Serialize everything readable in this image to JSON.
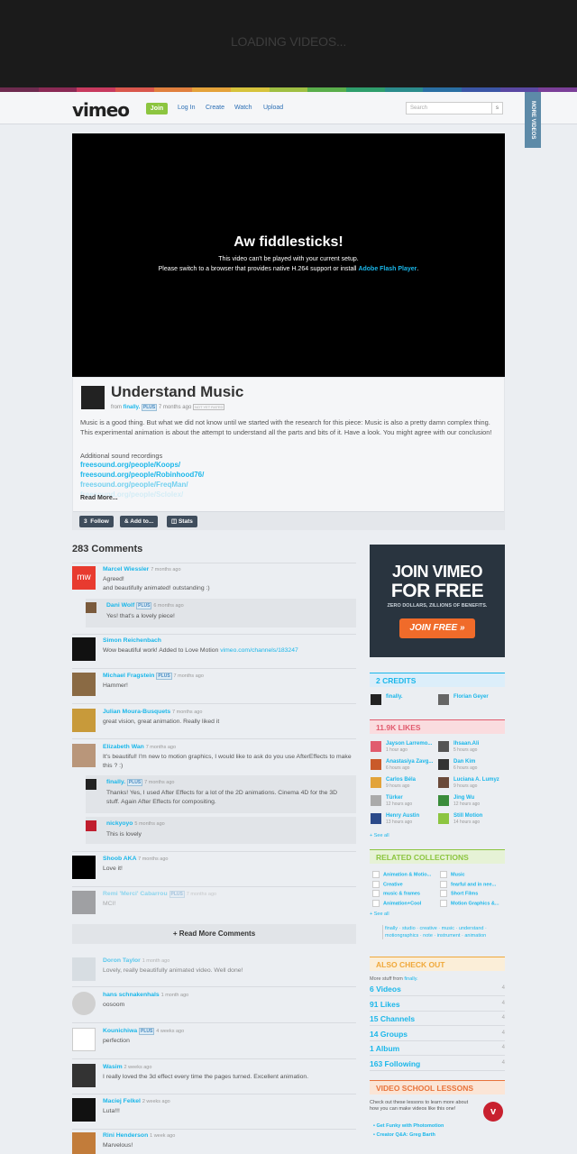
{
  "loading": "LOADING VIDEOS...",
  "stripe": [
    "#6d2b4f",
    "#8a2a55",
    "#c73a5f",
    "#d9574d",
    "#e07f3e",
    "#e4a23a",
    "#d6c33c",
    "#9fbf43",
    "#5aae4b",
    "#2f9e6c",
    "#2b8c8c",
    "#2a6fa3",
    "#3b56a6",
    "#5a48a2",
    "#7b3f98"
  ],
  "header": {
    "logo": "vimeo",
    "join": "Join",
    "login": "Log In",
    "create": "Create",
    "watch": "Watch",
    "upload": "Upload",
    "search_placeholder": "Search",
    "search_btn": "s",
    "more_videos": "MORE VIDEOS"
  },
  "player": {
    "title": "Aw fiddlesticks!",
    "msg1": "This video can't be played with your current setup.",
    "msg2": "Please switch to a browser that provides native H.264 support or install",
    "flash": "Adobe Flash Player",
    "period": "."
  },
  "video": {
    "title": "Understand Music",
    "from": "from",
    "author": "finally.",
    "plus": "PLUS",
    "ago": "7 months ago",
    "rated": "NOT YET RATED",
    "desc": "Music is a good thing. But what we did not know until we started with the research for this piece: Music is also a pretty damn complex thing. This experimental animation is about the attempt to understand all the parts and bits of it. Have a look. You might agree with our conclusion!",
    "additional": "Additional sound recordings",
    "links": [
      "freesound.org/people/Koops/",
      "freesound.org/people/Robinhood76/",
      "freesound.org/people/FreqMan/",
      "freesound.org/people/Sclolex/"
    ],
    "readmore": "Read More...",
    "follow": "Follow",
    "follow_count": "3",
    "addto": "Add to...",
    "stats": "Stats"
  },
  "comments_header": "283 Comments",
  "comments": [
    {
      "name": "Marcel Wiessler",
      "time": "7 months ago",
      "text": "Agreed!\nand beautifully animated! outstanding :)"
    },
    {
      "name": "Dani Wolf",
      "plus": "PLUS",
      "time": "6 months ago",
      "text": "Yes! that's a lovely piece!"
    },
    {
      "name": "Simon Reichenbach",
      "time": "7 months ago",
      "text": "Wow beautiful work! Added to Love Motion",
      "link": "vimeo.com/channels/183247"
    },
    {
      "name": "Michael Fragstein",
      "plus": "PLUS",
      "time": "7 months ago",
      "text": "Hammer!"
    },
    {
      "name": "Julian Moura-Busquets",
      "time": "7 months ago",
      "text": "great vision, great animation. Really liked it"
    },
    {
      "name": "Elizabeth Wan",
      "time": "7 months ago",
      "text": "It's beautiful! I'm new to motion graphics, I would like to ask do you use AfterEffects to make this ? :)"
    },
    {
      "name": "finally.",
      "plus": "PLUS",
      "time": "7 months ago",
      "text": "Thanks! Yes, I used After Effects for a lot of the 2D animations. Cinema 4D for the 3D stuff. Again After Effects for compositing."
    },
    {
      "name": "nickyoyo",
      "time": "5 months ago",
      "text": "This is lovely"
    },
    {
      "name": "Shoob AKA",
      "time": "7 months ago",
      "text": "Love it!"
    },
    {
      "name": "Remi 'Merci' Cabarrou",
      "plus": "PLUS",
      "time": "7 months ago",
      "text": "MCI!"
    }
  ],
  "read_more_comments": "+  Read More Comments",
  "comments2": [
    {
      "name": "Doron Taylor",
      "time": "1 month ago",
      "text": "Lovely, really beautifully animated video. Well done!"
    },
    {
      "name": "hans schnakenhals",
      "time": "1 month ago",
      "text": "oosoom"
    },
    {
      "name": "Kounichiwa",
      "plus": "PLUS",
      "time": "4 weeks ago",
      "text": "perfection"
    },
    {
      "name": "Wasim",
      "time": "2 weeks ago",
      "text": "I really loved the 3d effect every time the pages turned. Excellent animation."
    },
    {
      "name": "Maciej Felkel",
      "time": "2 weeks ago",
      "text": "Luta!!!"
    },
    {
      "name": "Rini Henderson",
      "time": "1 week ago",
      "text": "Marvelous!"
    }
  ],
  "ad": {
    "l1": "JOIN VIMEO",
    "l2": "FOR FREE",
    "l3": "ZERO DOLLARS, ZILLIONS OF BENEFITS.",
    "btn": "JOIN FREE »"
  },
  "credits": {
    "title": "2 CREDITS",
    "items": [
      "finally.",
      "Florian Geyer"
    ]
  },
  "likes": {
    "title": "11.9K LIKES",
    "items": [
      {
        "name": "Jayson Larremo...",
        "time": "1 hour ago"
      },
      {
        "name": "Ihsaan.Ali",
        "time": "5 hours ago"
      },
      {
        "name": "Anastasiya Zavg...",
        "time": "6 hours ago"
      },
      {
        "name": "Dan Kim",
        "time": "6 hours ago"
      },
      {
        "name": "Carlos Béla",
        "time": "9 hours ago"
      },
      {
        "name": "Luciana A. Lumyz",
        "time": "9 hours ago"
      },
      {
        "name": "Türker",
        "time": "12 hours ago"
      },
      {
        "name": "Jing Wu",
        "time": "12 hours ago"
      },
      {
        "name": "Henry Austin",
        "time": "13 hours ago"
      },
      {
        "name": "Still Motion",
        "time": "14 hours ago"
      }
    ],
    "seeall": "+ See all"
  },
  "collections": {
    "title": "RELATED COLLECTIONS",
    "items": [
      "Animation & Motio...",
      "Music",
      "Creative",
      "fearful and in nee...",
      "music & frames",
      "Short Films",
      "Animation+Cool",
      "Motion Graphics &..."
    ],
    "seeall": "+ See all",
    "tags": "finally · studio · creative · music · understand · motiongraphics · note · instrument · animation"
  },
  "also": {
    "title": "ALSO CHECK OUT",
    "more": "More stuff from",
    "author": "finally.",
    "items": [
      {
        "n": "6 Videos",
        "c": "4"
      },
      {
        "n": "91 Likes",
        "c": "4"
      },
      {
        "n": "15 Channels",
        "c": "4"
      },
      {
        "n": "14 Groups",
        "c": "4"
      },
      {
        "n": "1 Album",
        "c": "4"
      },
      {
        "n": "163 Following",
        "c": "4"
      }
    ]
  },
  "school": {
    "title": "VIDEO SCHOOL LESSONS",
    "text": "Check out these lessons to learn more about how you can make videos like this one!",
    "lessons": [
      "Get Funky with Photomotion",
      "Creator Q&A: Greg Barth"
    ]
  }
}
